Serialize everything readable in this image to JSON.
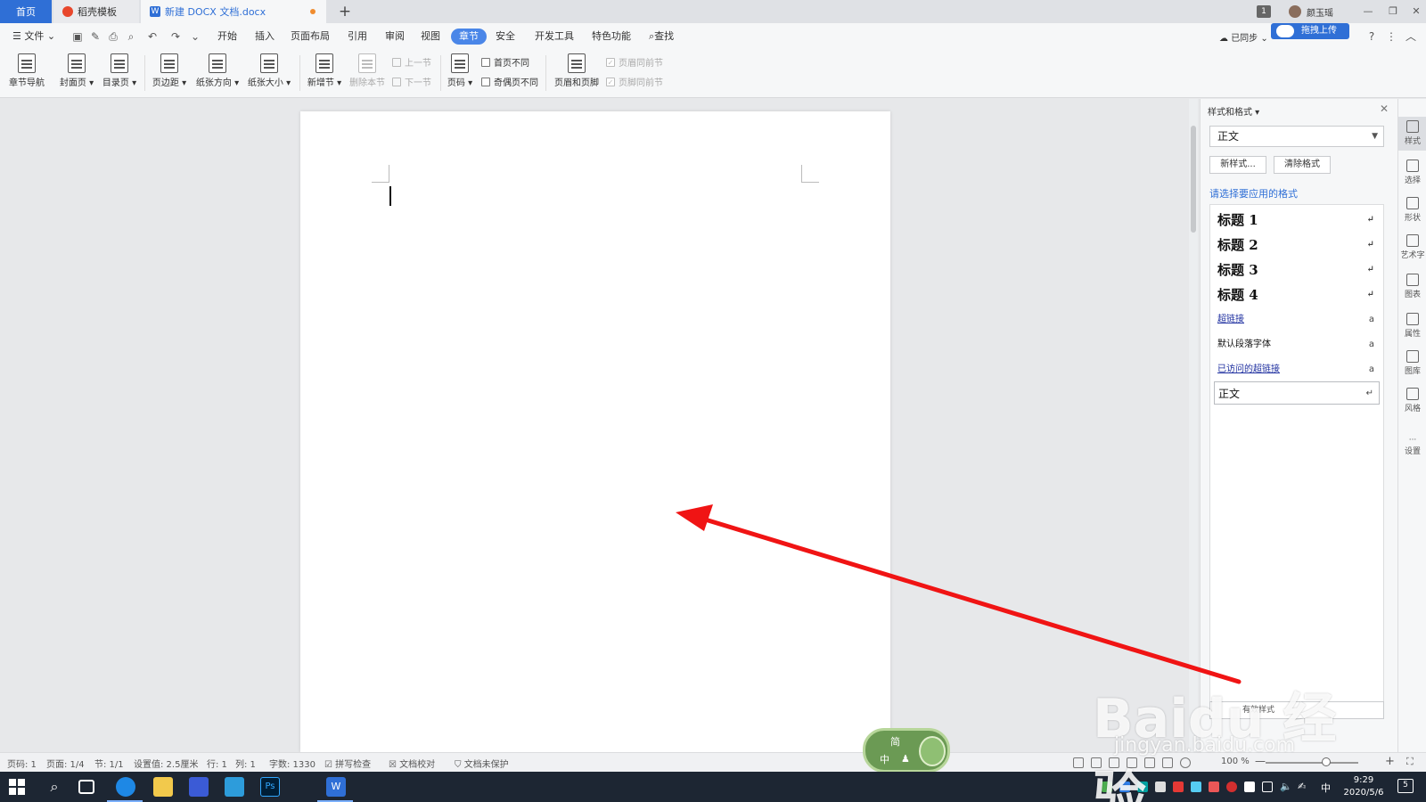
{
  "tabs": {
    "home": "首页",
    "daoke": "稻壳模板",
    "doc": "新建 DOCX 文档.docx"
  },
  "titlebar": {
    "badge": "1",
    "username": "颜玉瑶"
  },
  "menu": {
    "file": "文件",
    "items": [
      "开始",
      "插入",
      "页面布局",
      "引用",
      "审阅",
      "视图",
      "章节",
      "安全",
      "开发工具",
      "特色功能"
    ],
    "active": "章节",
    "search": "查找",
    "sync": "已同步",
    "upload": "拖拽上传"
  },
  "ribbon": {
    "chapter_nav": "章节导航",
    "cover": "封面页",
    "toc": "目录页",
    "margin": "页边距",
    "orientation": "纸张方向",
    "size": "纸张大小",
    "new_section": "新增节",
    "delete_section": "删除本节",
    "prev_section": "上一节",
    "next_section": "下一节",
    "page_number": "页码",
    "first_page_diff": "首页不同",
    "odd_even_diff": "奇偶页不同",
    "header_footer": "页眉和页脚",
    "header_same": "页眉同前节",
    "footer_same": "页脚同前节"
  },
  "style_pane": {
    "title": "样式和格式",
    "current": "正文",
    "new_style": "新样式...",
    "clear_format": "清除格式",
    "hint": "请选择要应用的格式",
    "styles": [
      "标题 1",
      "标题 2",
      "标题 3",
      "标题 4",
      "超链接",
      "默认段落字体",
      "已访问的超链接",
      "正文"
    ],
    "show_label": "有效样式"
  },
  "right_tools": [
    "样式",
    "选择",
    "形状",
    "艺术字",
    "图表",
    "属性",
    "图库",
    "风格",
    "设置"
  ],
  "status": {
    "page_num": "页码: 1",
    "pages": "页面: 1/4",
    "section": "节: 1/1",
    "setting": "设置值: 2.5厘米",
    "row": "行: 1",
    "col": "列: 1",
    "words": "字数: 1330",
    "spell": "拼写检查",
    "proof": "文档校对",
    "protect": "文档未保护",
    "zoom": "100 %"
  },
  "ime_widget": {
    "line1": "简",
    "line2": "中"
  },
  "taskbar": {
    "time": "9:29",
    "date": "2020/5/6",
    "ime": "中",
    "notifications": "5"
  },
  "watermark": {
    "brand": "Baidu 经验",
    "url": "jingyan.baidu.com"
  },
  "colors": {
    "accent": "#2f6fd6",
    "annotation": "#f01414"
  }
}
